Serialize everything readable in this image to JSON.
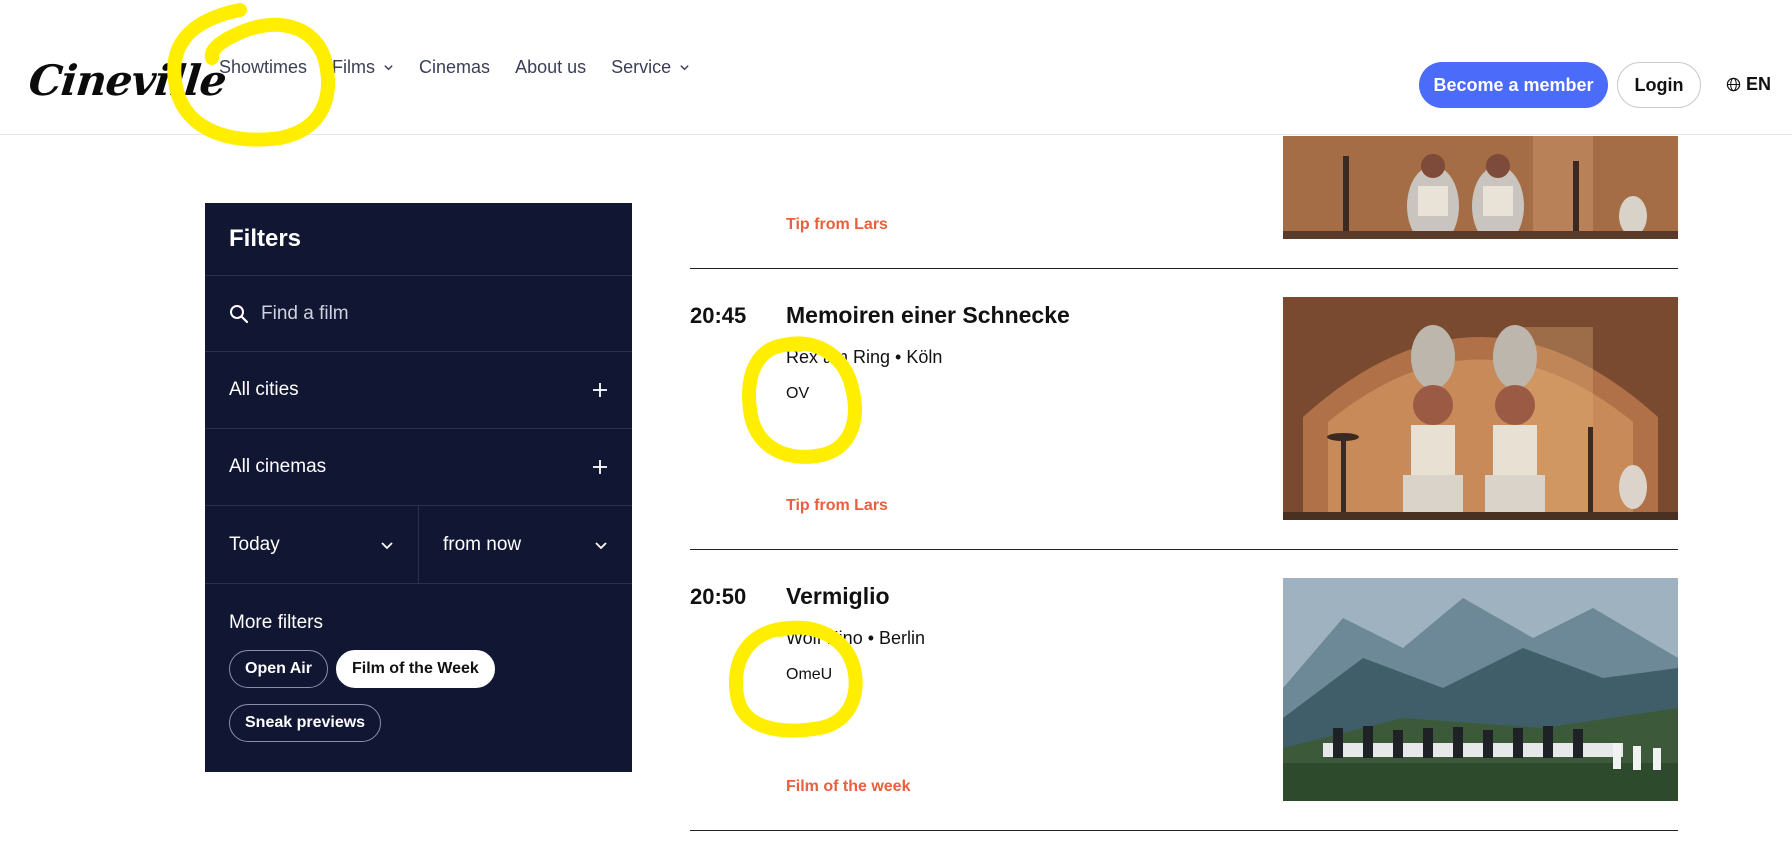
{
  "header": {
    "logo": "Cineville",
    "nav": [
      {
        "label": "Showtimes",
        "has_dropdown": false
      },
      {
        "label": "Films",
        "has_dropdown": true
      },
      {
        "label": "Cinemas",
        "has_dropdown": false
      },
      {
        "label": "About us",
        "has_dropdown": false
      },
      {
        "label": "Service",
        "has_dropdown": true
      }
    ],
    "member_button": "Become a member",
    "login_button": "Login",
    "language": "EN"
  },
  "filters": {
    "title": "Filters",
    "search_placeholder": "Find a film",
    "cities": "All cities",
    "cinemas": "All cinemas",
    "day": "Today",
    "time": "from now",
    "more_title": "More filters",
    "chips": [
      {
        "label": "Open Air",
        "active": false
      },
      {
        "label": "Film of the Week",
        "active": true
      },
      {
        "label": "Sneak previews",
        "active": false
      }
    ]
  },
  "showtimes": [
    {
      "tip": "Tip from Lars"
    },
    {
      "time": "20:45",
      "title": "Memoiren einer Schnecke",
      "venue": "Rex am Ring • Köln",
      "version": "OV",
      "tip": "Tip from Lars"
    },
    {
      "time": "20:50",
      "title": "Vermiglio",
      "venue": "Wolf Kino • Berlin",
      "version": "OmeU",
      "tip": "Film of the week"
    }
  ],
  "colors": {
    "accent_blue": "#4b6bfb",
    "panel_navy": "#111633",
    "tip_orange": "#e8603c",
    "highlight_yellow": "#ffee00"
  }
}
